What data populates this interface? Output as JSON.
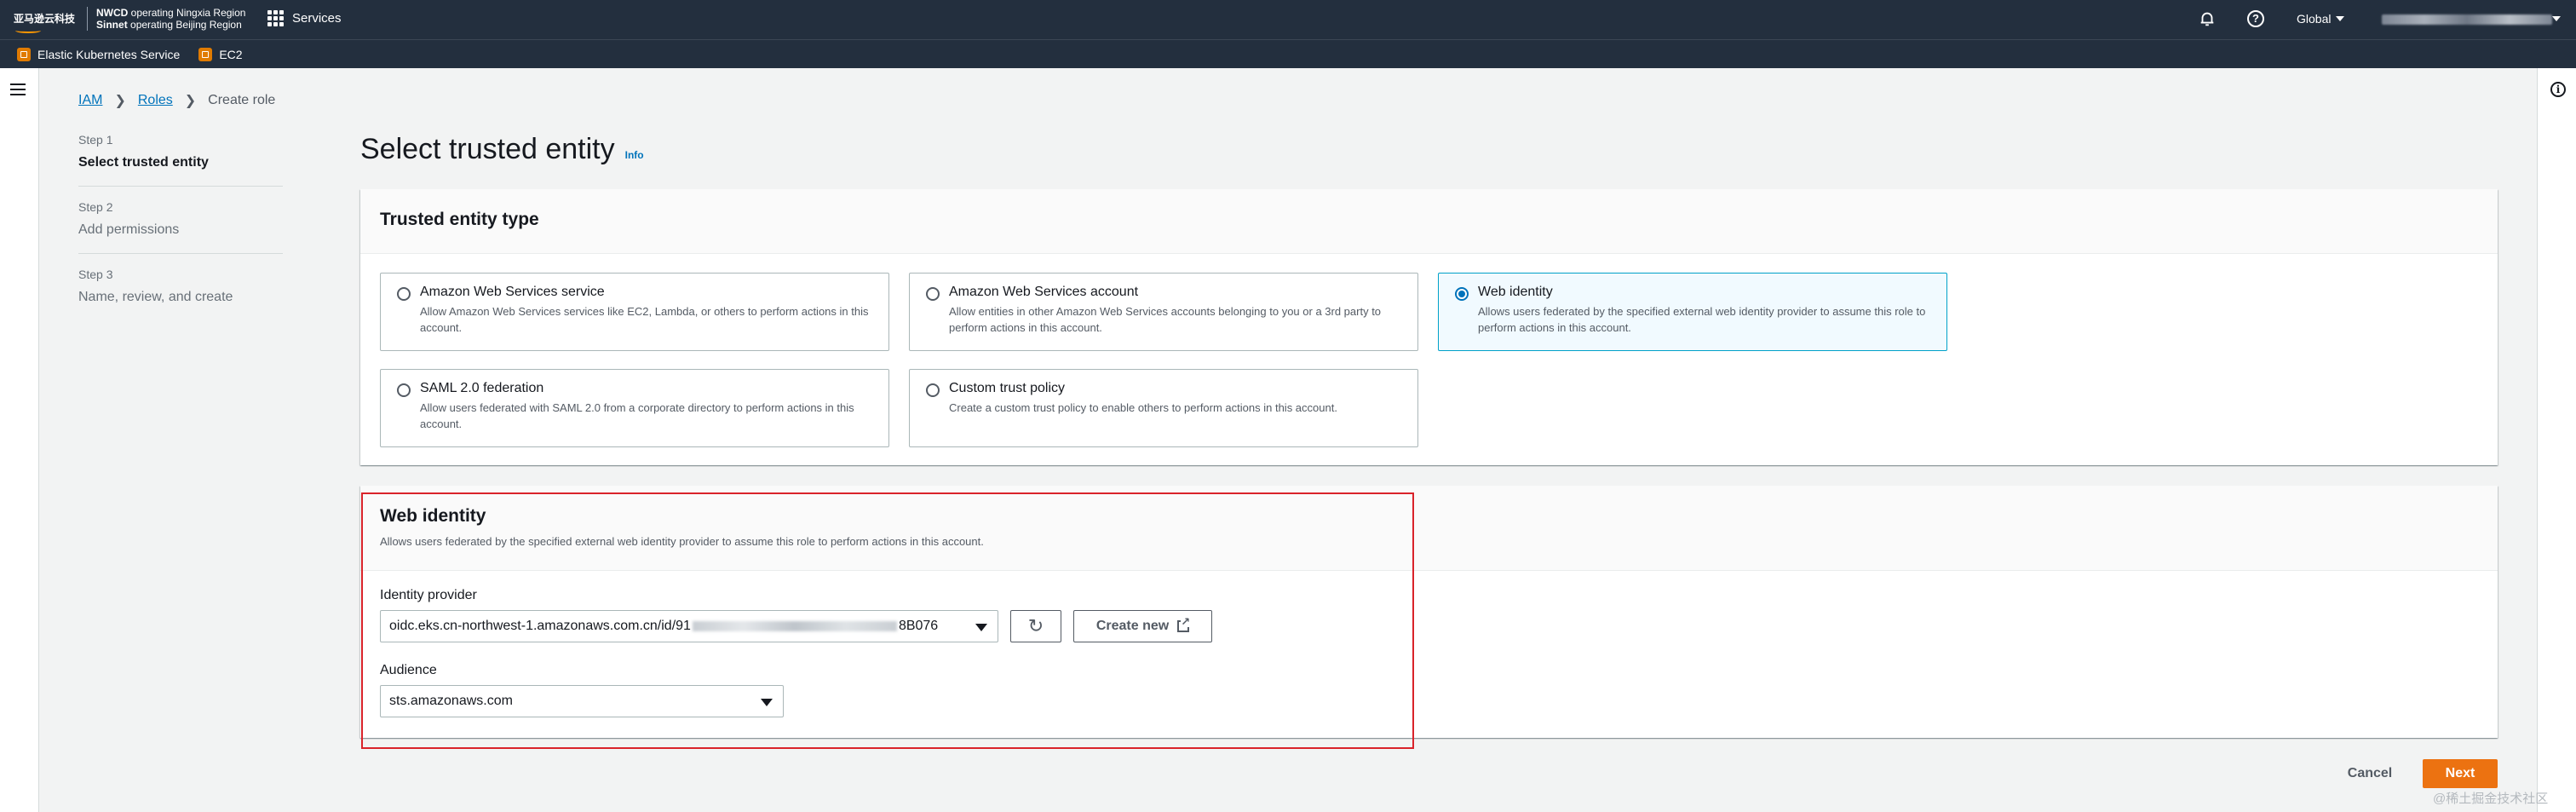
{
  "topnav": {
    "logo_text": "亚马逊云科技",
    "region_line1_bold": "NWCD",
    "region_line1": " operating Ningxia Region",
    "region_line2_bold": "Sinnet",
    "region_line2": " operating Beijing Region",
    "services_label": "Services",
    "region_selector": "Global",
    "icons": [
      "grid-icon",
      "bell-icon",
      "help-icon"
    ]
  },
  "favorites": [
    {
      "label": "Elastic Kubernetes Service",
      "icon": "eks-icon"
    },
    {
      "label": "EC2",
      "icon": "ec2-icon"
    }
  ],
  "breadcrumb": {
    "items": [
      "IAM",
      "Roles"
    ],
    "current": "Create role"
  },
  "steps": [
    {
      "num": "Step 1",
      "title": "Select trusted entity",
      "active": true
    },
    {
      "num": "Step 2",
      "title": "Add permissions",
      "active": false
    },
    {
      "num": "Step 3",
      "title": "Name, review, and create",
      "active": false
    }
  ],
  "page": {
    "title": "Select trusted entity",
    "info": "Info"
  },
  "trusted_entity": {
    "header": "Trusted entity type",
    "options": [
      {
        "title": "Amazon Web Services service",
        "desc": "Allow Amazon Web Services services like EC2, Lambda, or others to perform actions in this account.",
        "selected": false
      },
      {
        "title": "Amazon Web Services account",
        "desc": "Allow entities in other Amazon Web Services accounts belonging to you or a 3rd party to perform actions in this account.",
        "selected": false
      },
      {
        "title": "Web identity",
        "desc": "Allows users federated by the specified external web identity provider to assume this role to perform actions in this account.",
        "selected": true
      },
      {
        "title": "SAML 2.0 federation",
        "desc": "Allow users federated with SAML 2.0 from a corporate directory to perform actions in this account.",
        "selected": false
      },
      {
        "title": "Custom trust policy",
        "desc": "Create a custom trust policy to enable others to perform actions in this account.",
        "selected": false
      }
    ]
  },
  "web_identity": {
    "header": "Web identity",
    "description": "Allows users federated by the specified external web identity provider to assume this role to perform actions in this account.",
    "identity_provider_label": "Identity provider",
    "identity_provider_prefix": "oidc.eks.cn-northwest-1.amazonaws.com.cn/id/91",
    "identity_provider_suffix": "8B076",
    "create_new": "Create new",
    "audience_label": "Audience",
    "audience_value": "sts.amazonaws.com"
  },
  "footer": {
    "cancel": "Cancel",
    "next": "Next"
  },
  "watermark": "@稀土掘金技术社区",
  "colors": {
    "nav_bg": "#232f3e",
    "link": "#0073bb",
    "primary": "#ec7211",
    "selected_border": "#00a1c9",
    "highlight": "#d9232a"
  }
}
